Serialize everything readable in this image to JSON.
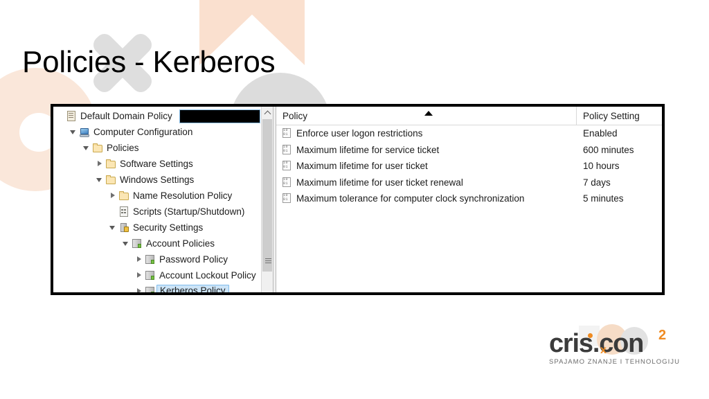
{
  "slide": {
    "title": "Policies - Kerberos"
  },
  "window": {
    "tree": {
      "items": [
        {
          "label": "Default Domain Policy",
          "icon": "document-icon",
          "indent": 0,
          "expander": "none",
          "selected": false,
          "redacted": true
        },
        {
          "label": "Computer Configuration",
          "icon": "computer-icon",
          "indent": 1,
          "expander": "expanded",
          "selected": false,
          "redacted": false
        },
        {
          "label": "Policies",
          "icon": "folder-icon",
          "indent": 2,
          "expander": "expanded",
          "selected": false,
          "redacted": false
        },
        {
          "label": "Software Settings",
          "icon": "folder-icon",
          "indent": 3,
          "expander": "collapsed",
          "selected": false,
          "redacted": false
        },
        {
          "label": "Windows Settings",
          "icon": "folder-icon",
          "indent": 3,
          "expander": "expanded",
          "selected": false,
          "redacted": false
        },
        {
          "label": "Name Resolution Policy",
          "icon": "folder-icon",
          "indent": 4,
          "expander": "collapsed",
          "selected": false,
          "redacted": false
        },
        {
          "label": "Scripts (Startup/Shutdown)",
          "icon": "script-icon",
          "indent": 4,
          "expander": "none",
          "selected": false,
          "redacted": false
        },
        {
          "label": "Security Settings",
          "icon": "security-lock-icon",
          "indent": 4,
          "expander": "expanded",
          "selected": false,
          "redacted": false
        },
        {
          "label": "Account Policies",
          "icon": "servers-icon",
          "indent": 5,
          "expander": "expanded",
          "selected": false,
          "redacted": false
        },
        {
          "label": "Password Policy",
          "icon": "servers-icon",
          "indent": 6,
          "expander": "collapsed",
          "selected": false,
          "redacted": false
        },
        {
          "label": "Account Lockout Policy",
          "icon": "servers-icon",
          "indent": 6,
          "expander": "collapsed",
          "selected": false,
          "redacted": false
        },
        {
          "label": "Kerberos Policy",
          "icon": "servers-icon",
          "indent": 6,
          "expander": "collapsed",
          "selected": true,
          "redacted": false
        }
      ]
    },
    "list": {
      "columns": [
        {
          "label": "Policy",
          "sorted": "ascending"
        },
        {
          "label": "Policy Setting",
          "sorted": "none"
        }
      ],
      "rows": [
        {
          "policy": "Enforce user logon restrictions",
          "setting": "Enabled"
        },
        {
          "policy": "Maximum lifetime for service ticket",
          "setting": "600 minutes"
        },
        {
          "policy": "Maximum lifetime for user ticket",
          "setting": "10 hours"
        },
        {
          "policy": "Maximum lifetime for user ticket renewal",
          "setting": "7 days"
        },
        {
          "policy": "Maximum tolerance for computer clock synchronization",
          "setting": "5 minutes"
        }
      ]
    }
  },
  "logo": {
    "part1": "cris",
    "separator": ".",
    "part2": "con",
    "superscript": "2",
    "subscript_x": "x",
    "tagline": "SPAJAMO ZNANJE I TEHNOLOGIJU",
    "accent_color": "#ef8b22",
    "text_color": "#3b3b3b"
  }
}
